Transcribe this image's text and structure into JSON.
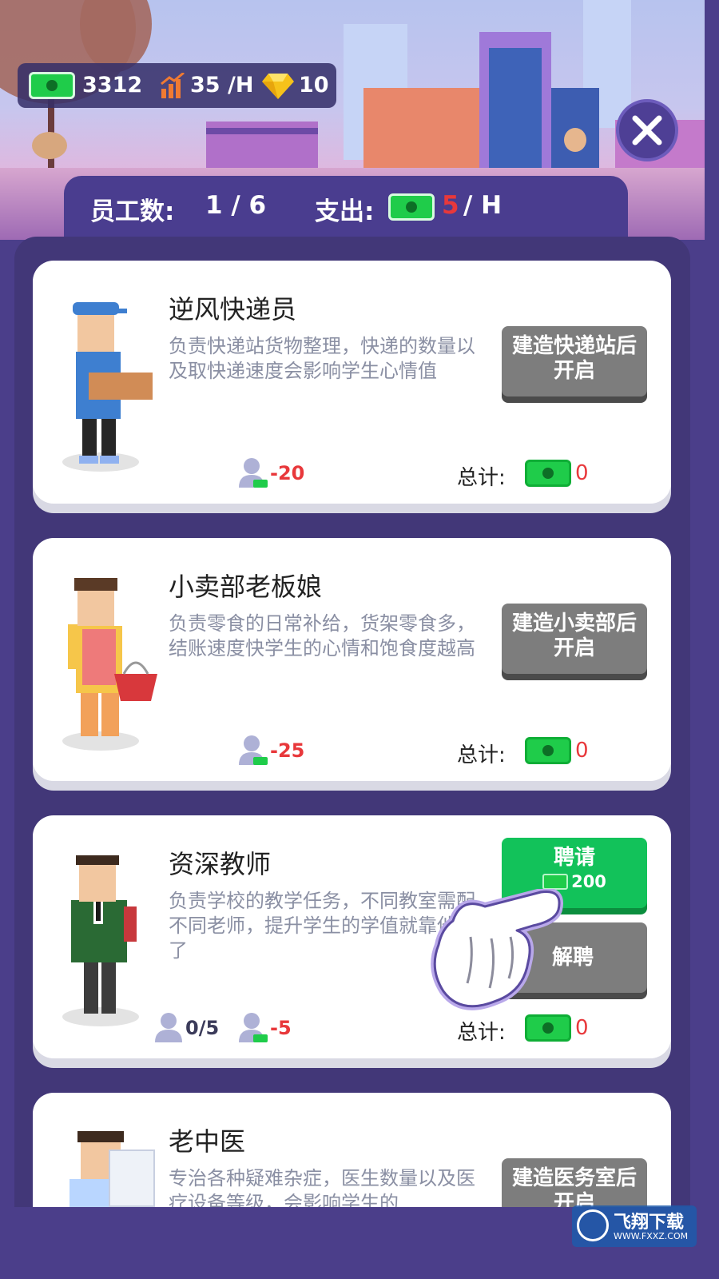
{
  "resources": {
    "cash": "3312",
    "income": "35 /H",
    "gems": "10"
  },
  "summary": {
    "staff_label": "员工数:",
    "staff_value": "1 / 6",
    "expense_label": "支出:",
    "expense_amount": "5",
    "expense_unit": "/ H"
  },
  "cards": [
    {
      "name": "逆风快递员",
      "description": "负责快递站货物整理，快递的数量以及取快递速度会影响学生心情值",
      "cost": "-20",
      "total_label": "总计:",
      "total_value": "0",
      "button_line1": "建造快递站后",
      "button_line2": "开启"
    },
    {
      "name": "小卖部老板娘",
      "description": "负责零食的日常补给，货架零食多，结账速度快学生的心情和饱食度越高",
      "cost": "-25",
      "total_label": "总计:",
      "total_value": "0",
      "button_line1": "建造小卖部后",
      "button_line2": "开启"
    },
    {
      "name": "资深教师",
      "description": "负责学校的教学任务，不同教室需配不同老师，提升学生的学值就靠他们了",
      "staff_count": "0/5",
      "cost": "-5",
      "total_label": "总计:",
      "total_value": "0",
      "hire_label": "聘请",
      "hire_price": "200",
      "fire_label": "解聘"
    },
    {
      "name": "老中医",
      "description": "专治各种疑难杂症，医生数量以及医疗设备等级，会影响学生的",
      "button_line1": "建造医务室后",
      "button_line2": "开启"
    }
  ],
  "watermark": {
    "title": "飞翔下载",
    "url": "WWW.FXXZ.COM"
  },
  "colors": {
    "panel": "#423778",
    "hire_green": "#12c25a",
    "disabled_gray": "#7d7d7d",
    "cost_red": "#e8383b"
  }
}
